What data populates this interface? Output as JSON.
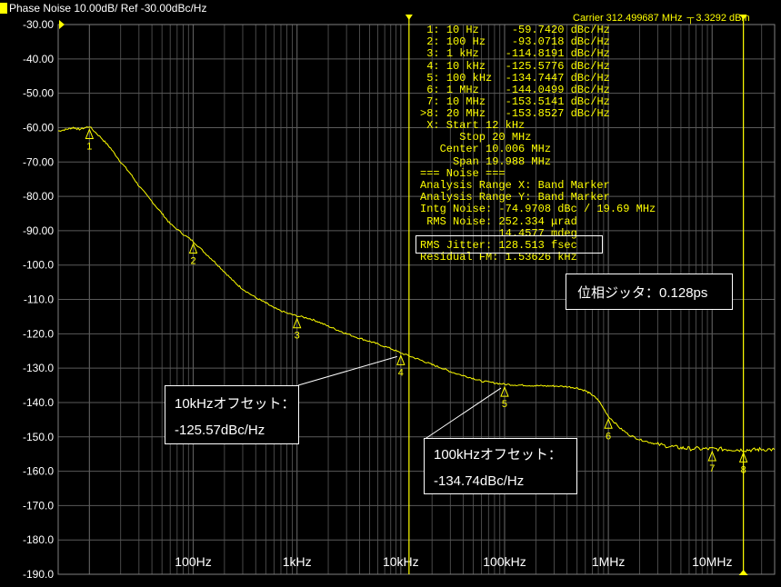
{
  "header": {
    "title": "Phase Noise 10.00dB/ Ref -30.00dBc/Hz",
    "carrier": "Carrier 312.499687 MHz",
    "carrier_power": "3.3292 dBm"
  },
  "marker_table": [
    {
      "id": "1:",
      "freq": "10 Hz",
      "value": "-59.7420 dBc/Hz"
    },
    {
      "id": "2:",
      "freq": "100 Hz",
      "value": "-93.0718 dBc/Hz"
    },
    {
      "id": "3:",
      "freq": "1 kHz",
      "value": "-114.8191 dBc/Hz"
    },
    {
      "id": "4:",
      "freq": "10 kHz",
      "value": "-125.5776 dBc/Hz"
    },
    {
      "id": "5:",
      "freq": "100 kHz",
      "value": "-134.7447 dBc/Hz"
    },
    {
      "id": "6:",
      "freq": "1 MHz",
      "value": "-144.0499 dBc/Hz"
    },
    {
      "id": "7:",
      "freq": "10 MHz",
      "value": "-153.5141 dBc/Hz"
    },
    {
      "id": ">8:",
      "freq": "20 MHz",
      "value": "-153.8527 dBc/Hz"
    }
  ],
  "range_info": [
    " X: Start 12 kHz",
    "      Stop 20 MHz",
    "   Center 10.006 MHz",
    "     Span 19.988 MHz",
    "=== Noise ===",
    "Analysis Range X: Band Marker",
    "Analysis Range Y: Band Marker",
    "Intg Noise: -74.9708 dBc / 19.69 MHz",
    " RMS Noise: 252.334 μrad",
    "            14.4577 mdeg",
    "RMS Jitter: 128.513 fsec",
    "Residual FM: 1.53626 kHz"
  ],
  "callouts": {
    "jitter": "位相ジッタ：0.128ps",
    "offset_10k_title": "10kHzオフセット：",
    "offset_10k_value": "-125.57dBc/Hz",
    "offset_100k_title": "100kHzオフセット：",
    "offset_100k_value": "-134.74dBc/Hz"
  },
  "colors": {
    "background": "#000000",
    "trace": "#ffff00",
    "grid": "#5a5a5a",
    "text": "#ffffff",
    "callout_border": "#ffffff"
  },
  "chart_data": {
    "type": "line",
    "x_scale": "log",
    "x_unit": "Hz",
    "xlim": [
      5,
      40000000
    ],
    "ylim": [
      -190,
      -30
    ],
    "y_ticks": [
      "-30.00",
      "-40.00",
      "-50.00",
      "-60.00",
      "-70.00",
      "-80.00",
      "-90.00",
      "-100.0",
      "-110.0",
      "-120.0",
      "-130.0",
      "-140.0",
      "-150.0",
      "-160.0",
      "-170.0",
      "-180.0",
      "-190.0"
    ],
    "x_tick_labels": [
      {
        "x": 100,
        "label": "100Hz"
      },
      {
        "x": 1000,
        "label": "1kHz"
      },
      {
        "x": 10000,
        "label": "10kHz"
      },
      {
        "x": 100000,
        "label": "100kHz"
      },
      {
        "x": 1000000,
        "label": "1MHz"
      },
      {
        "x": 10000000,
        "label": "10MHz"
      }
    ],
    "grid": true,
    "series": [
      {
        "x": [
          5,
          6,
          7,
          8,
          10,
          13,
          16,
          20,
          25,
          30,
          40,
          50,
          60,
          80,
          100,
          130,
          160,
          200,
          250,
          300,
          400,
          500,
          600,
          800,
          1000,
          1300,
          1600,
          2000,
          2500,
          3000,
          4000,
          5000,
          6000,
          8000,
          10000,
          13000,
          16000,
          20000,
          25000,
          30000,
          40000,
          50000,
          60000,
          80000,
          100000,
          130000,
          160000,
          200000,
          250000,
          300000,
          400000,
          500000,
          600000,
          700000,
          800000,
          1000000,
          1300000,
          1600000,
          2000000,
          2500000,
          3000000,
          4000000,
          5000000,
          6000000,
          8000000,
          10000000,
          13000000,
          16000000,
          20000000,
          25000000,
          30000000,
          40000000
        ],
        "y": [
          -61,
          -60.5,
          -60,
          -60.5,
          -59.7,
          -63,
          -66,
          -70,
          -73.5,
          -77,
          -81.5,
          -85,
          -88,
          -91,
          -93.1,
          -96.5,
          -99,
          -102,
          -105,
          -107,
          -109.5,
          -111,
          -112.5,
          -114,
          -114.8,
          -115.5,
          -116.5,
          -117.8,
          -119,
          -120,
          -121.3,
          -122.2,
          -123,
          -124.3,
          -125.6,
          -126.8,
          -127.8,
          -129,
          -130,
          -131,
          -132.2,
          -133,
          -133.8,
          -134.3,
          -134.7,
          -134.9,
          -135,
          -135.1,
          -135.2,
          -135.2,
          -135.4,
          -135.8,
          -136.6,
          -137.8,
          -139.3,
          -144,
          -147.5,
          -149.5,
          -150.8,
          -151.6,
          -152.2,
          -152.8,
          -153.2,
          -153.4,
          -153.5,
          -153.5,
          -153.6,
          -153.7,
          -153.8,
          -153.8,
          -153.6,
          -153.7
        ]
      }
    ],
    "markers": [
      {
        "label": "1",
        "x": 10,
        "y": -59.742
      },
      {
        "label": "2",
        "x": 100,
        "y": -93.0718
      },
      {
        "label": "3",
        "x": 1000,
        "y": -114.8191
      },
      {
        "label": "4",
        "x": 10000,
        "y": -125.5776
      },
      {
        "label": "5",
        "x": 100000,
        "y": -134.7447
      },
      {
        "label": "6",
        "x": 1000000,
        "y": -144.0499
      },
      {
        "label": "7",
        "x": 10000000,
        "y": -153.5141
      },
      {
        "label": "8",
        "x": 20000000,
        "y": -153.8527
      }
    ],
    "band_lines_x": [
      12000,
      20000000
    ]
  }
}
